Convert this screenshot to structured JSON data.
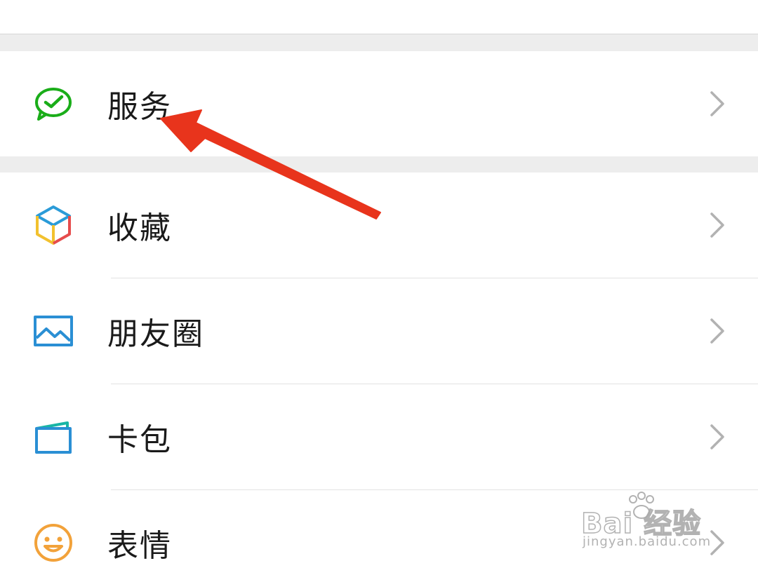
{
  "menu": {
    "group1": [
      {
        "label": "服务",
        "icon": "wechat-pay-icon"
      }
    ],
    "group2": [
      {
        "label": "收藏",
        "icon": "favorites-cube-icon"
      },
      {
        "label": "朋友圈",
        "icon": "moments-picture-icon"
      },
      {
        "label": "卡包",
        "icon": "card-wallet-icon"
      },
      {
        "label": "表情",
        "icon": "smiley-face-icon"
      }
    ]
  },
  "annotation": {
    "arrow_color": "#e8341c",
    "points_to": "服务"
  },
  "watermark": {
    "brand": "Bai 经验",
    "url": "jingyan.baidu.com"
  },
  "colors": {
    "background": "#ededed",
    "row_bg": "#ffffff",
    "text": "#1a1a1a",
    "chevron": "#b2b2b2",
    "wechat_green": "#07c160"
  }
}
